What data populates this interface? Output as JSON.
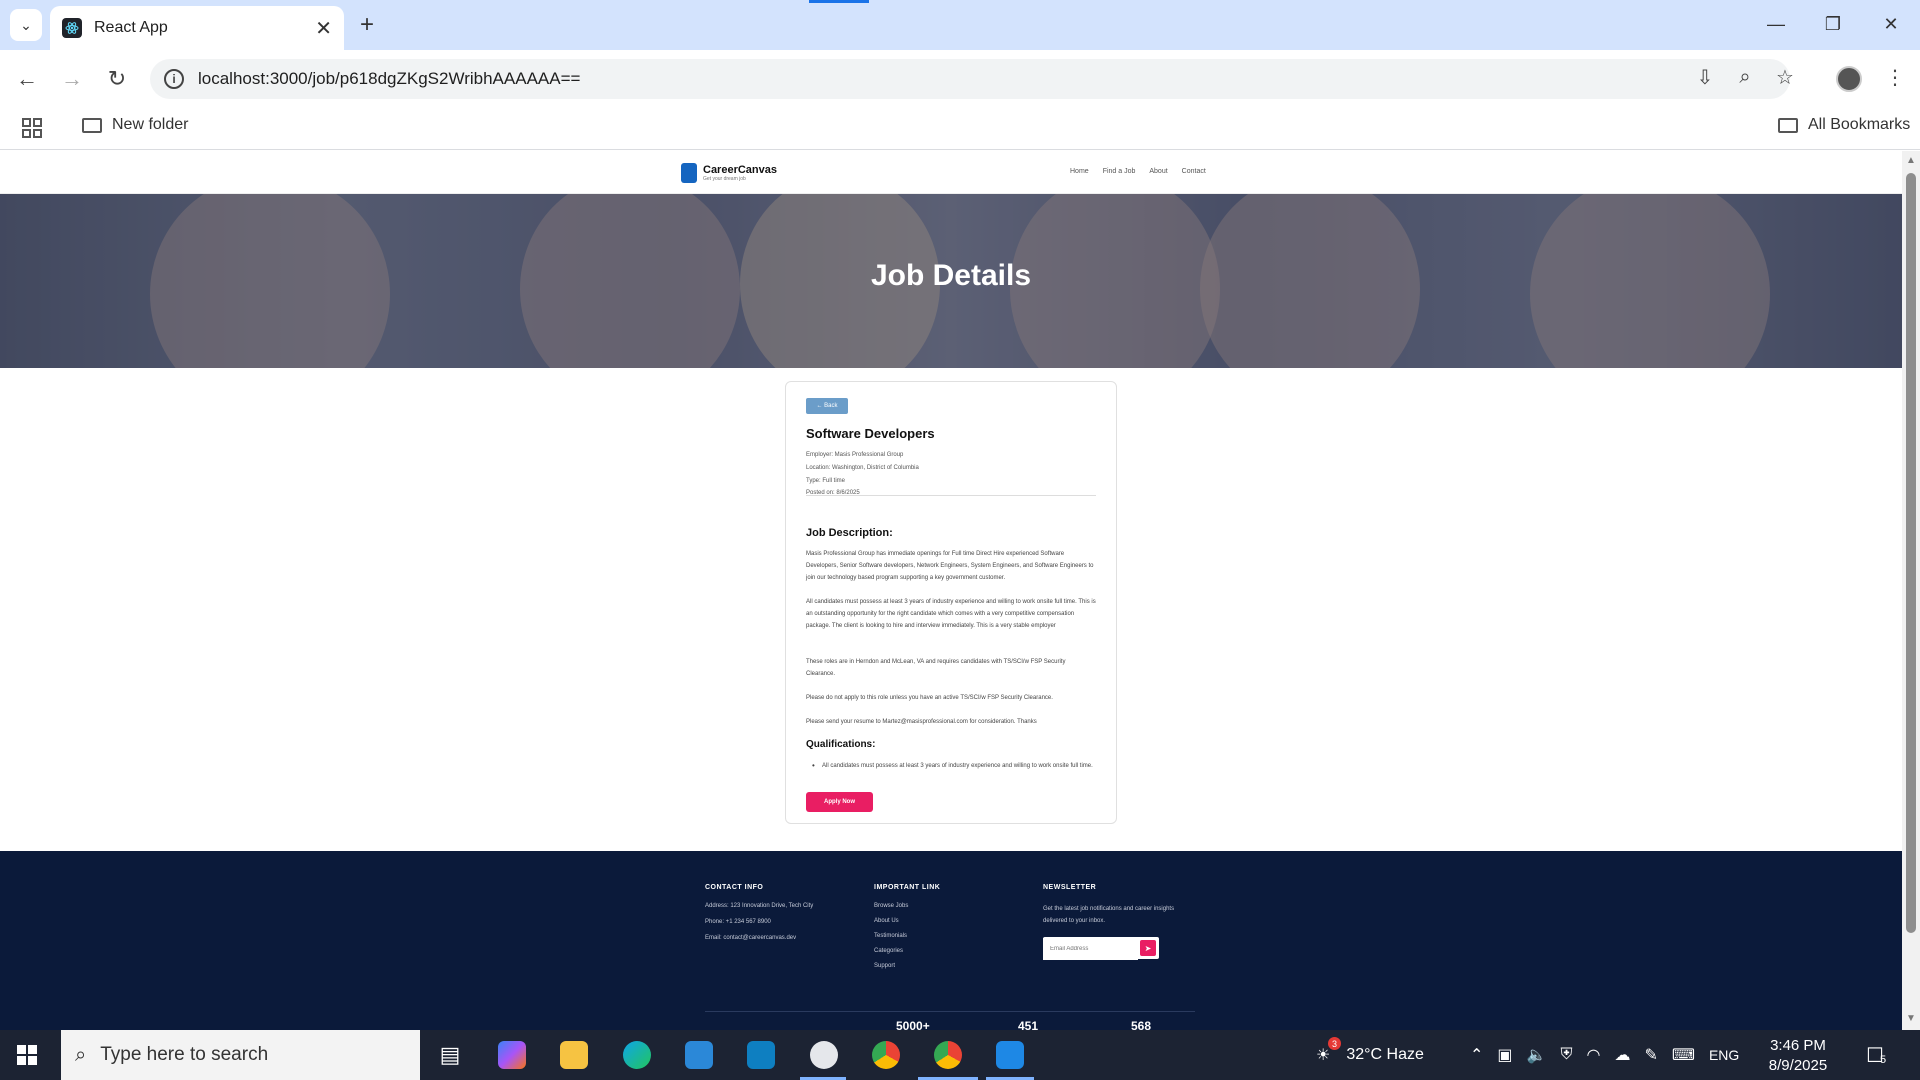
{
  "browser": {
    "tab_title": "React App",
    "url": "localhost:3000/job/p618dgZKgS2WribhAAAAAA==",
    "bookmark_folder": "New folder",
    "all_bookmarks": "All Bookmarks"
  },
  "site": {
    "brand": "CareerCanvas",
    "tagline": "Get your dream job",
    "nav": [
      "Home",
      "Find a Job",
      "About",
      "Contact"
    ]
  },
  "hero": {
    "title": "Job Details"
  },
  "job": {
    "back_label": "← Back",
    "title": "Software Developers",
    "employer": "Employer: Masis Professional Group",
    "location": "Location: Washington, District of Columbia",
    "type": "Type: Full time",
    "posted": "Posted on: 8/6/2025",
    "description_heading": "Job Description:",
    "description": [
      "Masis Professional Group has immediate openings for Full time Direct Hire experienced Software Developers, Senior Software developers, Network Engineers, System Engineers, and Software Engineers to join our technology based program supporting a key government customer.",
      "All candidates must possess at least 3 years of industry experience and willing to work onsite full time. This is an outstanding opportunity for the right candidate which comes with a very competitive compensation package. The client is looking to hire and interview immediately. This is a very stable employer",
      "These roles are in Herndon and McLean, VA and requires candidates with TS/SCI/w FSP Security Clearance.",
      "Please do not apply to this role unless you have an active TS/SCI/w FSP Security Clearance.",
      "Please send your resume to Martez@masisprofessional.com for consideration. Thanks"
    ],
    "qualifications_heading": "Qualifications:",
    "qualifications": [
      "All candidates must possess at least 3 years of industry experience and willing to work onsite full time."
    ],
    "apply_label": "Apply Now"
  },
  "footer": {
    "contact_heading": "CONTACT INFO",
    "address": "Address: 123 Innovation Drive, Tech City",
    "phone": "Phone: +1 234 567 8900",
    "email": "Email: contact@careercanvas.dev",
    "links_heading": "IMPORTANT LINK",
    "links": [
      "Browse Jobs",
      "About Us",
      "Testimonials",
      "Categories",
      "Support"
    ],
    "newsletter_heading": "NEWSLETTER",
    "newsletter_text": "Get the latest job notifications and career insights delivered to your inbox.",
    "email_placeholder": "Email Address",
    "stats": [
      "5000+",
      "451",
      "568"
    ]
  },
  "taskbar": {
    "search_placeholder": "Type here to search",
    "weather": "32°C  Haze",
    "weather_badge": "3",
    "lang": "ENG",
    "time": "3:46 PM",
    "date": "8/9/2025",
    "notifications": "5"
  }
}
